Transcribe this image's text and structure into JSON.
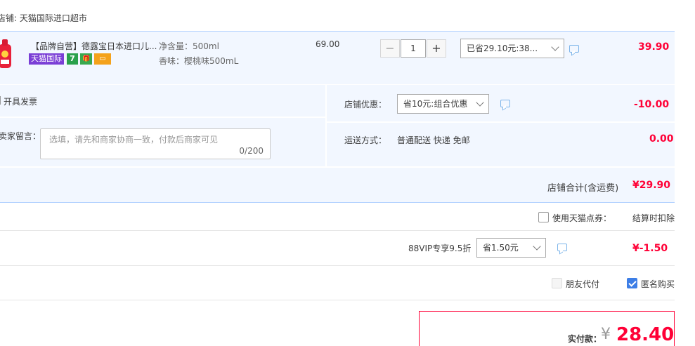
{
  "shop": {
    "title": "店铺: 天猫国际进口超市"
  },
  "item": {
    "title": "【品牌自营】德露宝日本进口儿...",
    "tags": {
      "tmall_global": "天猫国际",
      "seven": "7",
      "gift": "🎁",
      "card": "▭"
    },
    "spec_volume": "净含量：500ml",
    "spec_flavor": "香味：樱桃味500mL",
    "original_price": "69.00",
    "quantity": "1",
    "minus": "−",
    "plus": "+",
    "discount_select": "已省29.10元:38...",
    "price": "39.90"
  },
  "invoice": {
    "label": "开具发票"
  },
  "message": {
    "label": "卖家留言：",
    "placeholder": "选填，请先和商家协商一致，付款后商家可见",
    "counter": "0/200"
  },
  "shop_discount": {
    "label": "店铺优惠：",
    "select": "省10元:组合优惠",
    "amount": "-10.00"
  },
  "delivery": {
    "label": "运送方式：",
    "value": "普通配送 快递 免邮",
    "amount": "0.00"
  },
  "shop_total": {
    "label": "店铺合计(含运费)",
    "amount": "¥29.90"
  },
  "points": {
    "label": "使用天猫点券：",
    "value": "结算时扣除"
  },
  "vip": {
    "label": "88VIP专享9.5折",
    "select": "省1.50元",
    "amount": "¥-1.50"
  },
  "options": {
    "friend_pay": "朋友代付",
    "anonymous": "匿名购买"
  },
  "payment": {
    "label": "实付款：",
    "currency": "¥",
    "amount": "28.40"
  },
  "colors": {
    "accent_red": "#ff0036",
    "panel_bg": "#f2f7ff",
    "border_blue": "#b2d1ff",
    "check_blue": "#3d7ee6"
  }
}
